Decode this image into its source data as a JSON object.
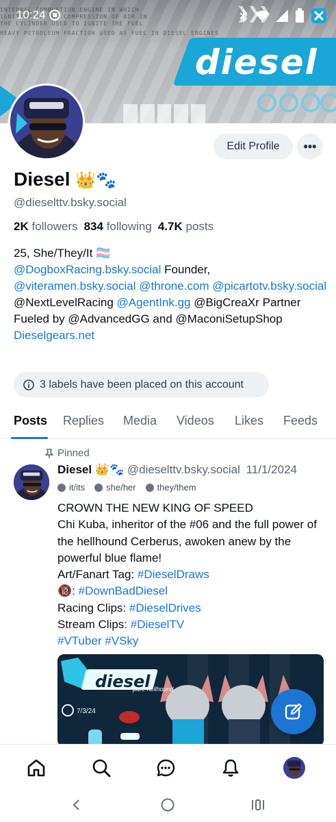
{
  "status_bar": {
    "time": "10:24",
    "icons": [
      "app-notification-icon",
      "bluetooth-icon",
      "wifi-icon",
      "signal-icon",
      "battery-icon"
    ]
  },
  "banner": {
    "logo_text": "diesel",
    "scribble_lines": [
      "INTERNAL COMBUSTION ENGINE IN WHICH",
      "IGNITION OF THE COMPRESSION OF AIR IN",
      "THE CYLINDER USED TO IGNITE THE FUEL",
      "HEAVY PETROLEUM FRACTION USED AS FUEL IN DIESEL ENGINES"
    ]
  },
  "profile": {
    "display_name": "Diesel",
    "name_emoji": "👑🐾",
    "handle": "@dieselttv.bsky.social",
    "followers_count": "2K",
    "followers_label": "followers",
    "following_count": "834",
    "following_label": "following",
    "posts_count": "4.7K",
    "posts_label": "posts",
    "edit_button": "Edit Profile",
    "more_button": "•••"
  },
  "bio": {
    "line1": "25, She/They/It",
    "line1_flag": "🏳️‍⚧️",
    "link_dogbox": "@DogboxRacing.bsky.social",
    "founder": "Founder,",
    "link_viteramen": "@viteramen.bsky.social",
    "link_throne": "@throne.com",
    "link_picarto": "@picartotv.bsky.social",
    "nextlevel": "@NextLevelRacing",
    "link_agentink": "@AgentInk.gg",
    "bigcrea": "@BigCreaXr",
    "partner": "Partner",
    "fueled": "Fueled by @AdvancedGG and @MaconiSetupShop",
    "link_dieselgears": "Dieselgears.net"
  },
  "labels_notice": "3 labels have been placed on this account",
  "tabs": [
    "Posts",
    "Replies",
    "Media",
    "Videos",
    "Likes",
    "Feeds"
  ],
  "post": {
    "pinned_label": "Pinned",
    "author": "Diesel",
    "author_emoji": "👑🐾",
    "handle": "@dieselttv.bsky.social",
    "date": "11/1/2024",
    "labels": [
      "it/its",
      "she/her",
      "they/them"
    ],
    "line1": "CROWN THE NEW KING OF SPEED",
    "line2": "Chi Kuba, inheritor of the #06 and the full power of the hellhound Cerberus, awoken anew by the powerful blue flame!",
    "art_prefix": "Art/Fanart Tag:",
    "art_tag": "#DieselDraws",
    "nsfw_prefix": "🔞:",
    "nsfw_tag": "#DownBadDiesel",
    "racing_prefix": "Racing Clips:",
    "racing_tag": "#DieselDrives",
    "stream_prefix": "Stream Clips:",
    "stream_tag": "#DieselTV",
    "tags_line": "#VTuber #VSky",
    "image_logo": "diesel",
    "image_sub": "pure hellhound",
    "image_date": "7/3/24"
  },
  "bottom_nav": [
    "home-icon",
    "search-icon",
    "chat-icon",
    "notifications-icon",
    "profile-avatar"
  ],
  "colors": {
    "link": "#1c74d4",
    "accent": "#1c74d4",
    "muted": "#5b6570",
    "pill_bg": "#eef1f4",
    "banner_blue": "#1aa6d6"
  }
}
